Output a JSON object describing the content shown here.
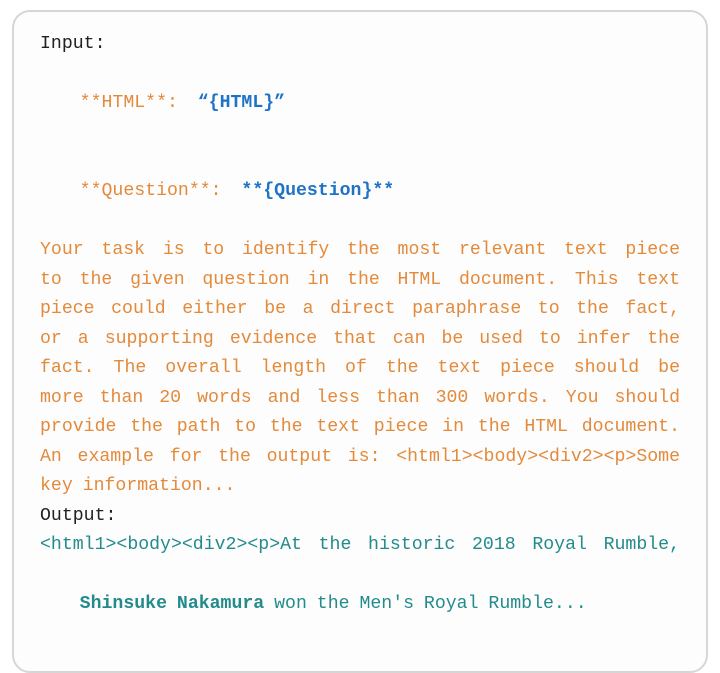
{
  "card": {
    "input_label": "Input:",
    "line1": {
      "html_key": "**HTML**:",
      "html_val": "“{HTML}”"
    },
    "line2": {
      "q_key": "**Question**:",
      "q_val": "**{Question}**"
    },
    "instr": {
      "l1": "Your task is to identify the most relevant text piece",
      "l2": "to the given question in the HTML document. This text",
      "l3": "piece could either be a direct paraphrase to the fact,",
      "l4": "or a supporting evidence that can be used to infer the",
      "l5": "fact. The overall length of the text piece should be",
      "l6": "more than 20 words and less than 300 words. You should",
      "l7": "provide the path to the text piece in the HTML document.",
      "l8": "An example for the output is: <html1><body><div2><p>Some",
      "l9": "key information..."
    },
    "output_label": "Output:",
    "out": {
      "l1_a": "<html1><body><div2><p>At the historic 2018 Royal Rumble,",
      "l2_name": "Shinsuke Nakamura",
      "l2_rest": " won the Men's Royal Rumble..."
    }
  }
}
